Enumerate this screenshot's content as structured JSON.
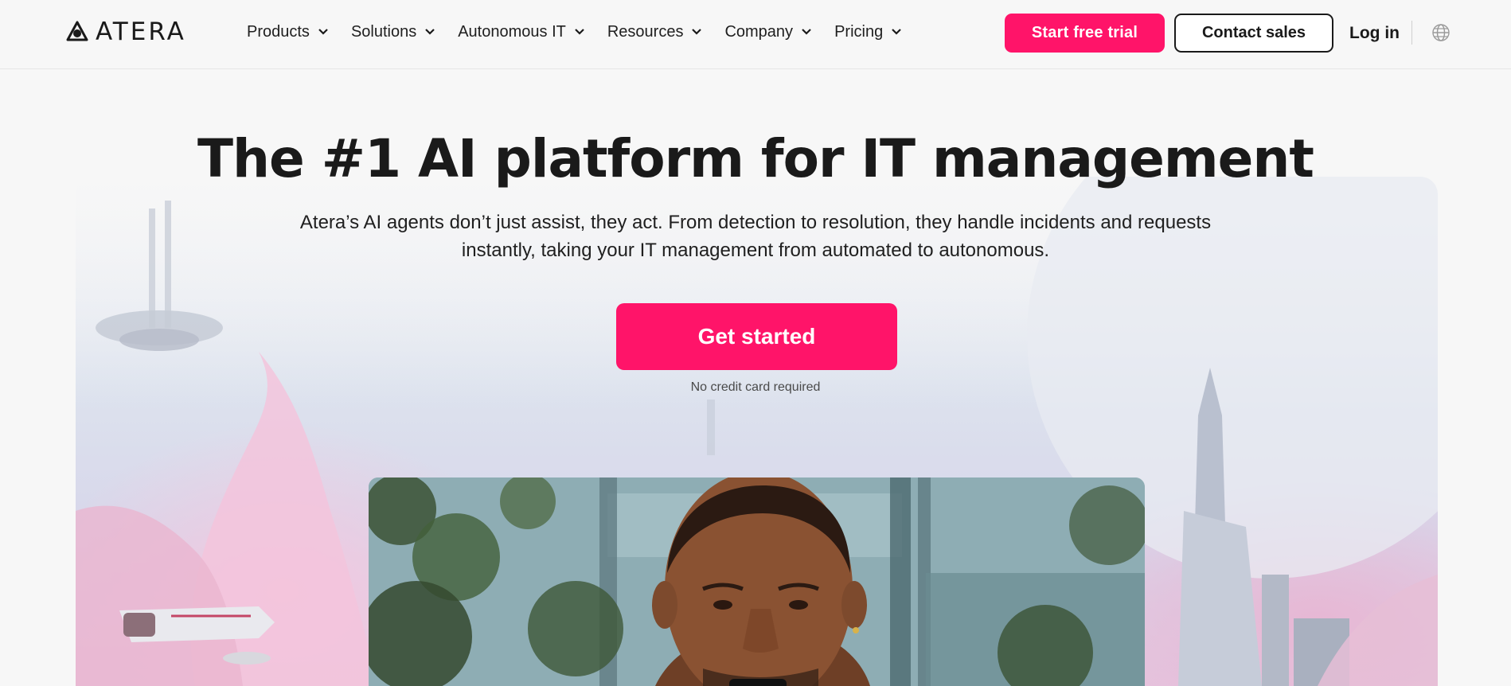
{
  "brand": {
    "name": "ATERA",
    "accent": "#ff1469"
  },
  "nav": {
    "items": [
      {
        "label": "Products"
      },
      {
        "label": "Solutions"
      },
      {
        "label": "Autonomous IT"
      },
      {
        "label": "Resources"
      },
      {
        "label": "Company"
      },
      {
        "label": "Pricing"
      }
    ],
    "trial_label": "Start free trial",
    "sales_label": "Contact sales",
    "login_label": "Log in",
    "language_icon": "globe-icon"
  },
  "hero": {
    "title": "The #1 AI platform for IT management",
    "subtitle": "Atera’s AI agents don’t just assist, they act. From detection to resolution, they handle incidents and requests instantly, taking your IT management from automated to autonomous.",
    "cta_label": "Get started",
    "cta_note": "No credit card required"
  }
}
